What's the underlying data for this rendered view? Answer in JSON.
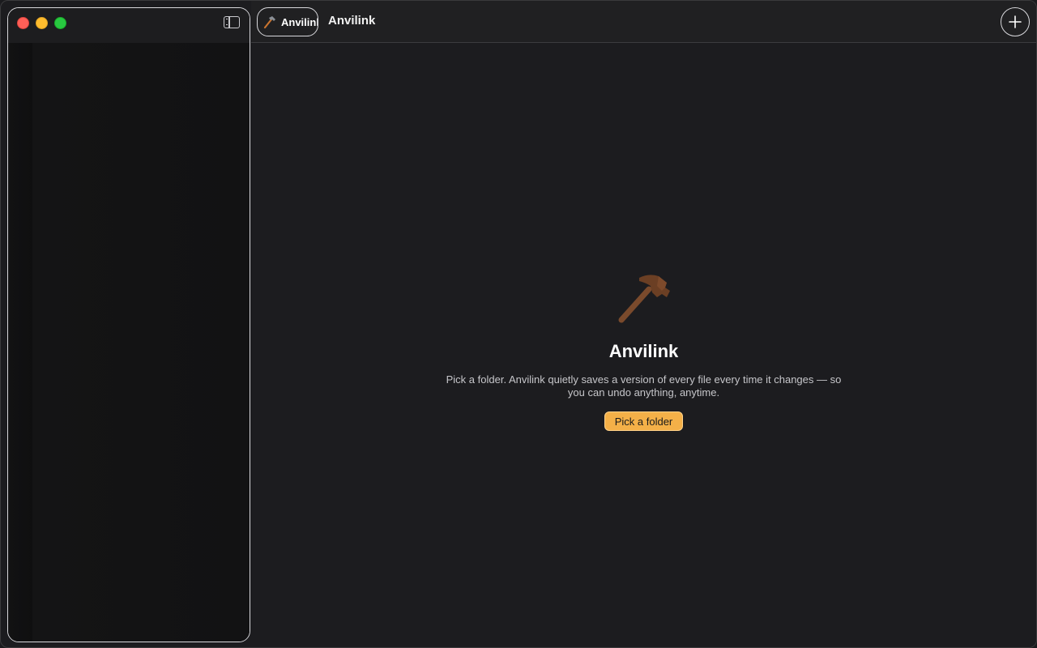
{
  "window": {
    "controls": [
      "close",
      "minimize",
      "zoom"
    ]
  },
  "sidebar": {
    "toggle_icon": "sidebar-toggle-icon"
  },
  "toolbar": {
    "tab_label": "Anvilink",
    "tab_icon": "hammer-icon",
    "title": "Anvilink",
    "add_icon": "plus-icon"
  },
  "empty_state": {
    "icon": "hammer-icon",
    "title": "Anvilink",
    "description": "Pick a folder. Anvilink quietly saves a version of every file every time it changes — so you can undo anything, anytime.",
    "button_label": "Pick a folder"
  },
  "colors": {
    "accent": "#f4b048",
    "background": "#1c1c1f",
    "sidebar": "#101011"
  }
}
